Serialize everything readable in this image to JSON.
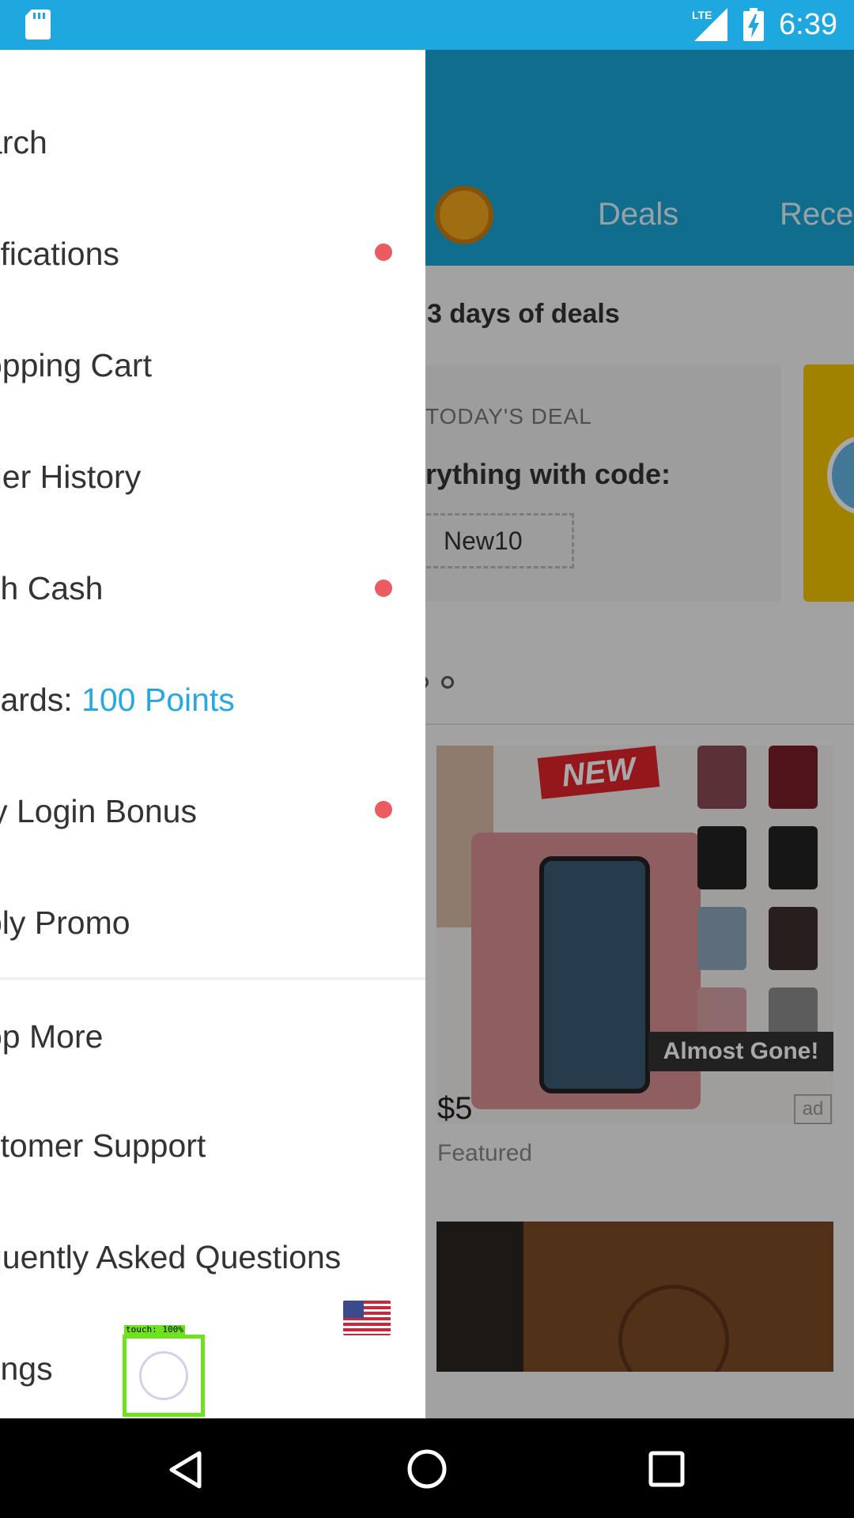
{
  "status_bar": {
    "network": "LTE",
    "time": "6:39",
    "icons": [
      "sd-card-icon",
      "lte-signal-icon",
      "battery-charging-icon"
    ]
  },
  "background_app": {
    "tabs": [
      "Deals",
      "Rece"
    ],
    "section_title": "3 days of deals",
    "deal_label": "TODAY'S DEAL",
    "deal_text": "erything with code:",
    "deal_code": "New10",
    "product": {
      "badge": "NEW",
      "tag": "Almost Gone!",
      "price": "$5",
      "subtitle": "Featured",
      "ad_label": "ad"
    }
  },
  "drawer": {
    "items": [
      {
        "label": "arch",
        "badge": false
      },
      {
        "label": "tifications",
        "badge": true
      },
      {
        "label": "opping Cart",
        "badge": false
      },
      {
        "label": "der History",
        "badge": false
      },
      {
        "label": "sh Cash",
        "badge": true
      },
      {
        "label": "vards: ",
        "points": "100 Points",
        "badge": false
      },
      {
        "label": "ly Login Bonus",
        "badge": true
      },
      {
        "label": "ply Promo",
        "badge": false
      },
      {
        "label": "op More",
        "badge": false
      },
      {
        "label": "stomer Support",
        "badge": false
      },
      {
        "label": "quently Asked Questions",
        "badge": false
      },
      {
        "label": "tings",
        "badge": false
      }
    ]
  },
  "touch_overlay": {
    "label": "touch: 100%"
  },
  "colors": {
    "status_bar": "#1fa8df",
    "accent": "#27a9e0",
    "badge": "#eb5b61",
    "touch_outline": "#6ee21d"
  }
}
